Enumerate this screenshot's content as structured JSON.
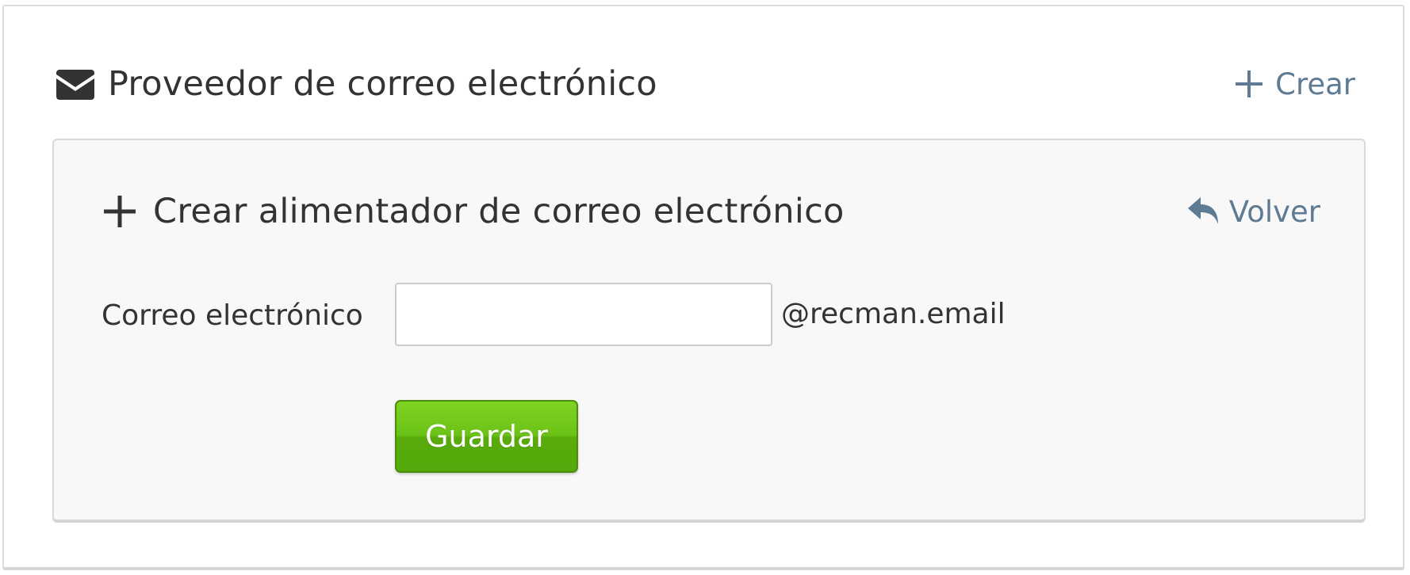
{
  "colors": {
    "text": "#333333",
    "link": "#5f7a93",
    "save_button": "#5cb30f",
    "inner_box_bg": "#f8f8f8"
  },
  "header": {
    "icon": "envelope-icon",
    "title": "Proveedor de correo electrónico",
    "create_icon": "plus-icon",
    "create_label": "Crear"
  },
  "form_panel": {
    "icon": "plus-icon",
    "title": "Crear alimentador de correo electrónico",
    "back_icon": "reply-arrow-icon",
    "back_label": "Volver",
    "email": {
      "label": "Correo electrónico",
      "value": "",
      "placeholder": "",
      "suffix": "@recman.email"
    },
    "save_label": "Guardar"
  }
}
